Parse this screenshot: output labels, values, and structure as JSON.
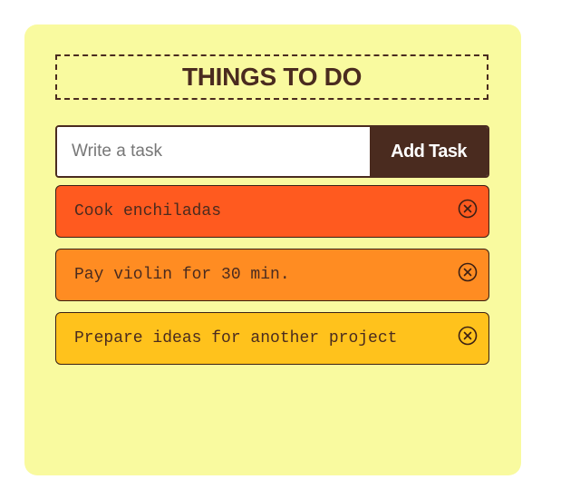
{
  "header": {
    "title": "THINGS TO DO"
  },
  "form": {
    "placeholder": "Write a task",
    "value": "",
    "add_label": "Add Task"
  },
  "tasks": [
    {
      "text": "Cook enchiladas",
      "color": "#ff5a1f",
      "delete_icon": "circle-x-icon"
    },
    {
      "text": "Pay violin for 30 min.",
      "color": "#ff8c22",
      "delete_icon": "circle-x-icon"
    },
    {
      "text": "Prepare ideas for another project",
      "color": "#ffc21c",
      "delete_icon": "circle-x-icon"
    }
  ],
  "colors": {
    "card_background": "#f9fa9f",
    "accent_dark": "#4a2b1f"
  }
}
